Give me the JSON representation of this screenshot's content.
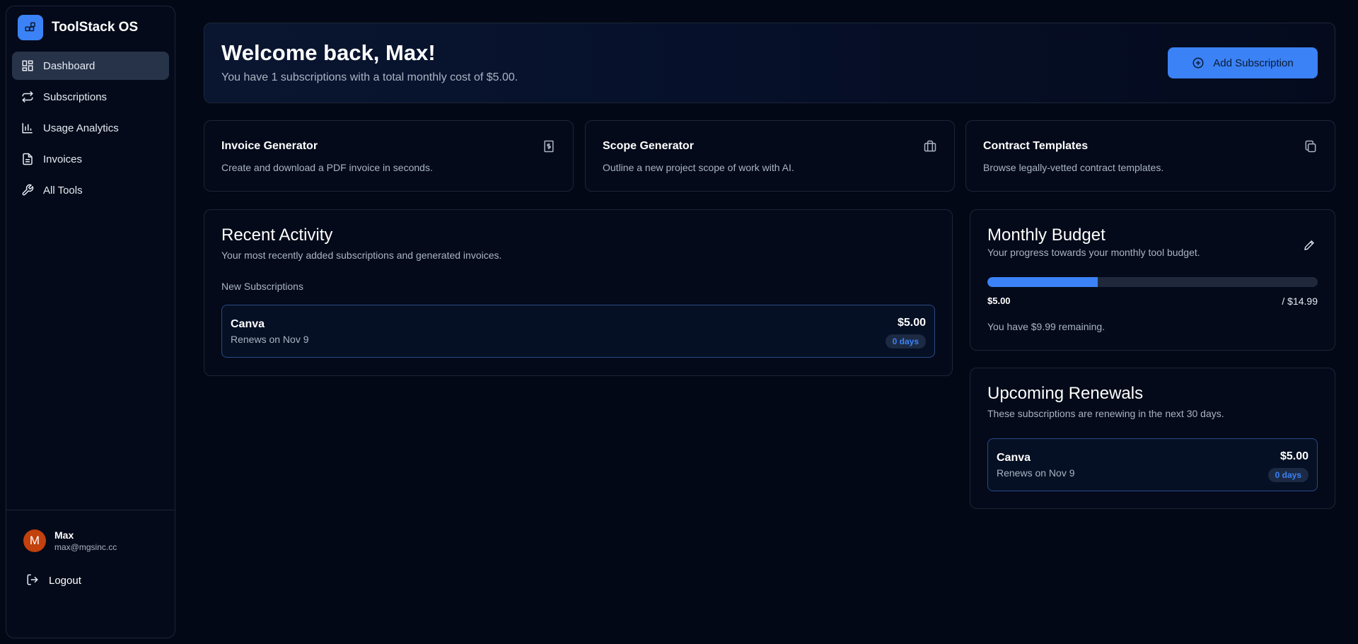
{
  "app": {
    "name": "ToolStack OS"
  },
  "sidebar": {
    "items": [
      {
        "label": "Dashboard",
        "icon": "dashboard-icon",
        "active": true
      },
      {
        "label": "Subscriptions",
        "icon": "repeat-icon"
      },
      {
        "label": "Usage Analytics",
        "icon": "bar-chart-icon"
      },
      {
        "label": "Invoices",
        "icon": "file-text-icon"
      },
      {
        "label": "All Tools",
        "icon": "wrench-icon"
      }
    ],
    "user": {
      "initial": "M",
      "name": "Max",
      "email": "max@mgsinc.cc"
    },
    "logout_label": "Logout"
  },
  "welcome": {
    "title": "Welcome back, Max!",
    "subtitle": "You have 1 subscriptions with a total monthly cost of $5.00.",
    "add_button": "Add Subscription"
  },
  "tools": [
    {
      "title": "Invoice Generator",
      "description": "Create and download a PDF invoice in seconds.",
      "icon": "receipt-dollar-icon"
    },
    {
      "title": "Scope Generator",
      "description": "Outline a new project scope of work with AI.",
      "icon": "briefcase-icon"
    },
    {
      "title": "Contract Templates",
      "description": "Browse legally-vetted contract templates.",
      "icon": "copy-icon"
    }
  ],
  "recent_activity": {
    "title": "Recent Activity",
    "subtitle": "Your most recently added subscriptions and generated invoices.",
    "section_label": "New Subscriptions",
    "items": [
      {
        "name": "Canva",
        "renews": "Renews on Nov 9",
        "price": "$5.00",
        "days": "0 days"
      }
    ]
  },
  "budget": {
    "title": "Monthly Budget",
    "subtitle": "Your progress towards your monthly tool budget.",
    "spent": "$5.00",
    "limit": "/ $14.99",
    "progress": 0.334,
    "remaining_text": "You have $9.99 remaining."
  },
  "renewals": {
    "title": "Upcoming Renewals",
    "subtitle": "These subscriptions are renewing in the next 30 days.",
    "items": [
      {
        "name": "Canva",
        "renews": "Renews on Nov 9",
        "price": "$5.00",
        "days": "0 days"
      }
    ]
  },
  "colors": {
    "accent": "#3b82f6",
    "background": "#030816",
    "avatar": "#c2410c"
  }
}
